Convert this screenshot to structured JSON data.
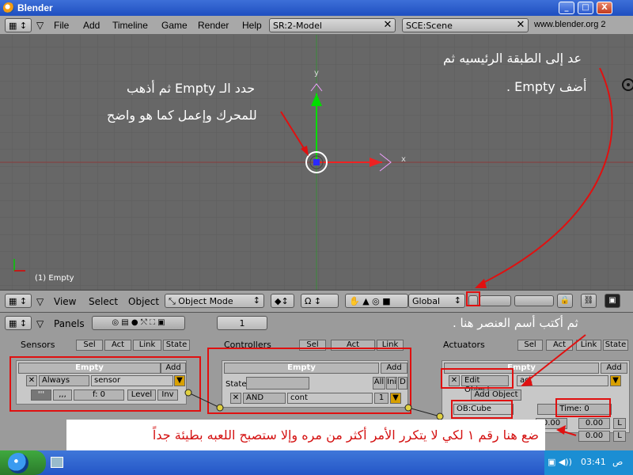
{
  "window": {
    "title": "Blender",
    "min": "_",
    "max": "□",
    "close": "X"
  },
  "menu": {
    "items": [
      "File",
      "Add",
      "Timeline",
      "Game",
      "Render",
      "Help"
    ],
    "screen_field": "SR:2-Model",
    "scene_field": "SCE:Scene",
    "site": "www.blender.org 2"
  },
  "viewport": {
    "object_label": "(1) Empty",
    "axis_y": "y",
    "axis_x": "x",
    "annotation_left_line1": "حدد الـ Empty ثم أذهب",
    "annotation_left_line2": "للمحرك وإعمل كما هو واضح",
    "annotation_right_line1": "عد إلى الطبقة الرئيسيه ثم",
    "annotation_right_line2": "أضف Empty ."
  },
  "view_header": {
    "view": "View",
    "select": "Select",
    "object": "Object",
    "mode": "Object Mode",
    "orientation": "Global"
  },
  "buttons_header": {
    "panels": "Panels",
    "frame": "1",
    "annotation": "ثم أكتب أسم العنصر هنا ."
  },
  "sensors": {
    "heading": "Sensors",
    "tabs": [
      "Sel",
      "Act",
      "Link",
      "State"
    ],
    "object": "Empty",
    "add": "Add",
    "type": "Always",
    "name": "sensor",
    "f_value": "f: 0",
    "level": "Level",
    "inv": "Inv",
    "pulse_true": "'''",
    "pulse_false": ",,,"
  },
  "controllers": {
    "heading": "Controllers",
    "tabs": [
      "Sel",
      "Act",
      "Link"
    ],
    "object": "Empty",
    "add": "Add",
    "state_label": "State",
    "all": "All",
    "ini": "Ini",
    "d": "D",
    "type": "AND",
    "name": "cont",
    "priority": "1"
  },
  "actuators": {
    "heading": "Actuators",
    "tabs": [
      "Sel",
      "Act",
      "Link",
      "State"
    ],
    "object": "Empty",
    "add": "Add",
    "type": "Edit Object",
    "name": "act",
    "mode": "Add Object",
    "ob_field": "OB:Cube",
    "time": "Time: 0",
    "val1": "0.00",
    "val2": "0.00",
    "val3": "0.00",
    "l": "L"
  },
  "note": {
    "text": "ضع هنا رقم ١ لكي لا يتكرر الأمر أكثر من مره وإلا ستصبح اللعبه بطيئة جداً"
  },
  "taskbar": {
    "clock": "03:41",
    "ampm": "ص"
  },
  "colors": {
    "grid_bg": "#676767",
    "annotation_red": "#e01010",
    "panel_bg": "#c8c8c8"
  }
}
